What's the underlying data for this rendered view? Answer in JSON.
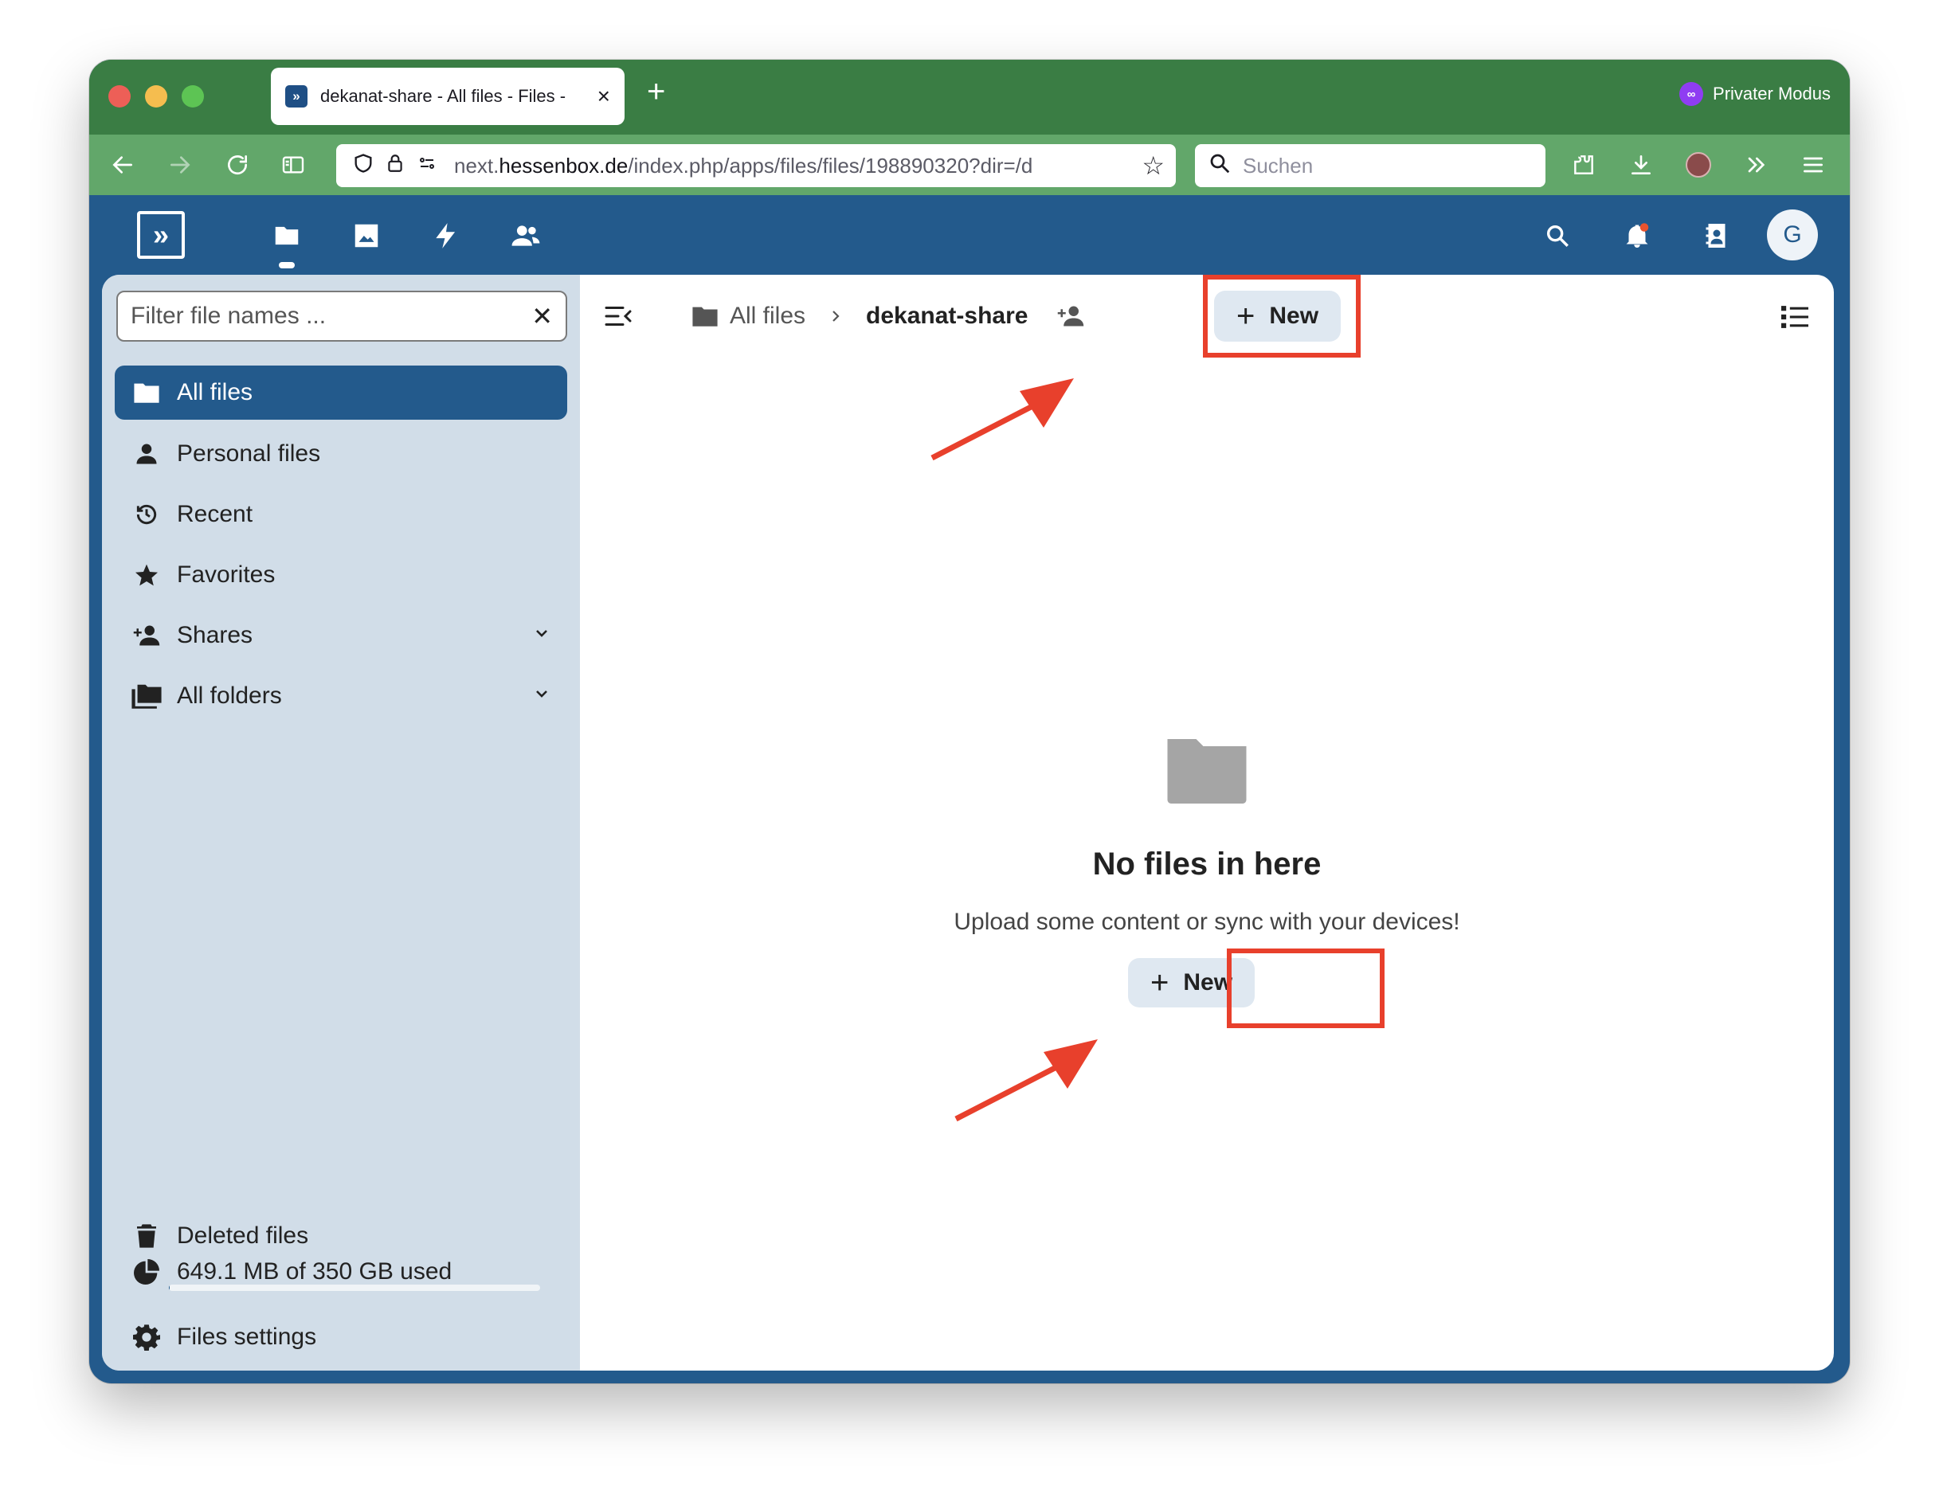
{
  "browser": {
    "tab_title": "dekanat-share - All files - Files - ",
    "private_label": "Privater Modus",
    "url_prefix": "next.",
    "url_domain": "hessenbox.de",
    "url_path": "/index.php/apps/files/files/198890320?dir=/d",
    "search_placeholder": "Suchen"
  },
  "sidebar": {
    "filter_placeholder": "Filter file names ...",
    "items": [
      {
        "label": "All files",
        "icon": "folder-icon",
        "active": true
      },
      {
        "label": "Personal files",
        "icon": "person-icon"
      },
      {
        "label": "Recent",
        "icon": "history-icon"
      },
      {
        "label": "Favorites",
        "icon": "star-icon"
      },
      {
        "label": "Shares",
        "icon": "share-icon",
        "expandable": true
      },
      {
        "label": "All folders",
        "icon": "folders-icon",
        "expandable": true
      }
    ],
    "deleted_label": "Deleted files",
    "quota_label": "649.1 MB of 350 GB used",
    "quota_fraction": 0.0019,
    "settings_label": "Files settings"
  },
  "main": {
    "breadcrumb_root": "All files",
    "breadcrumb_current": "dekanat-share",
    "new_label": "New",
    "empty_title": "No files in here",
    "empty_subtitle": "Upload some content or sync with your devices!",
    "empty_new_label": "New"
  },
  "colors": {
    "brand": "#235a8c",
    "browser_tabbar": "#3a7d44",
    "browser_navbar": "#62a76a",
    "annotation": "#e8402c"
  }
}
